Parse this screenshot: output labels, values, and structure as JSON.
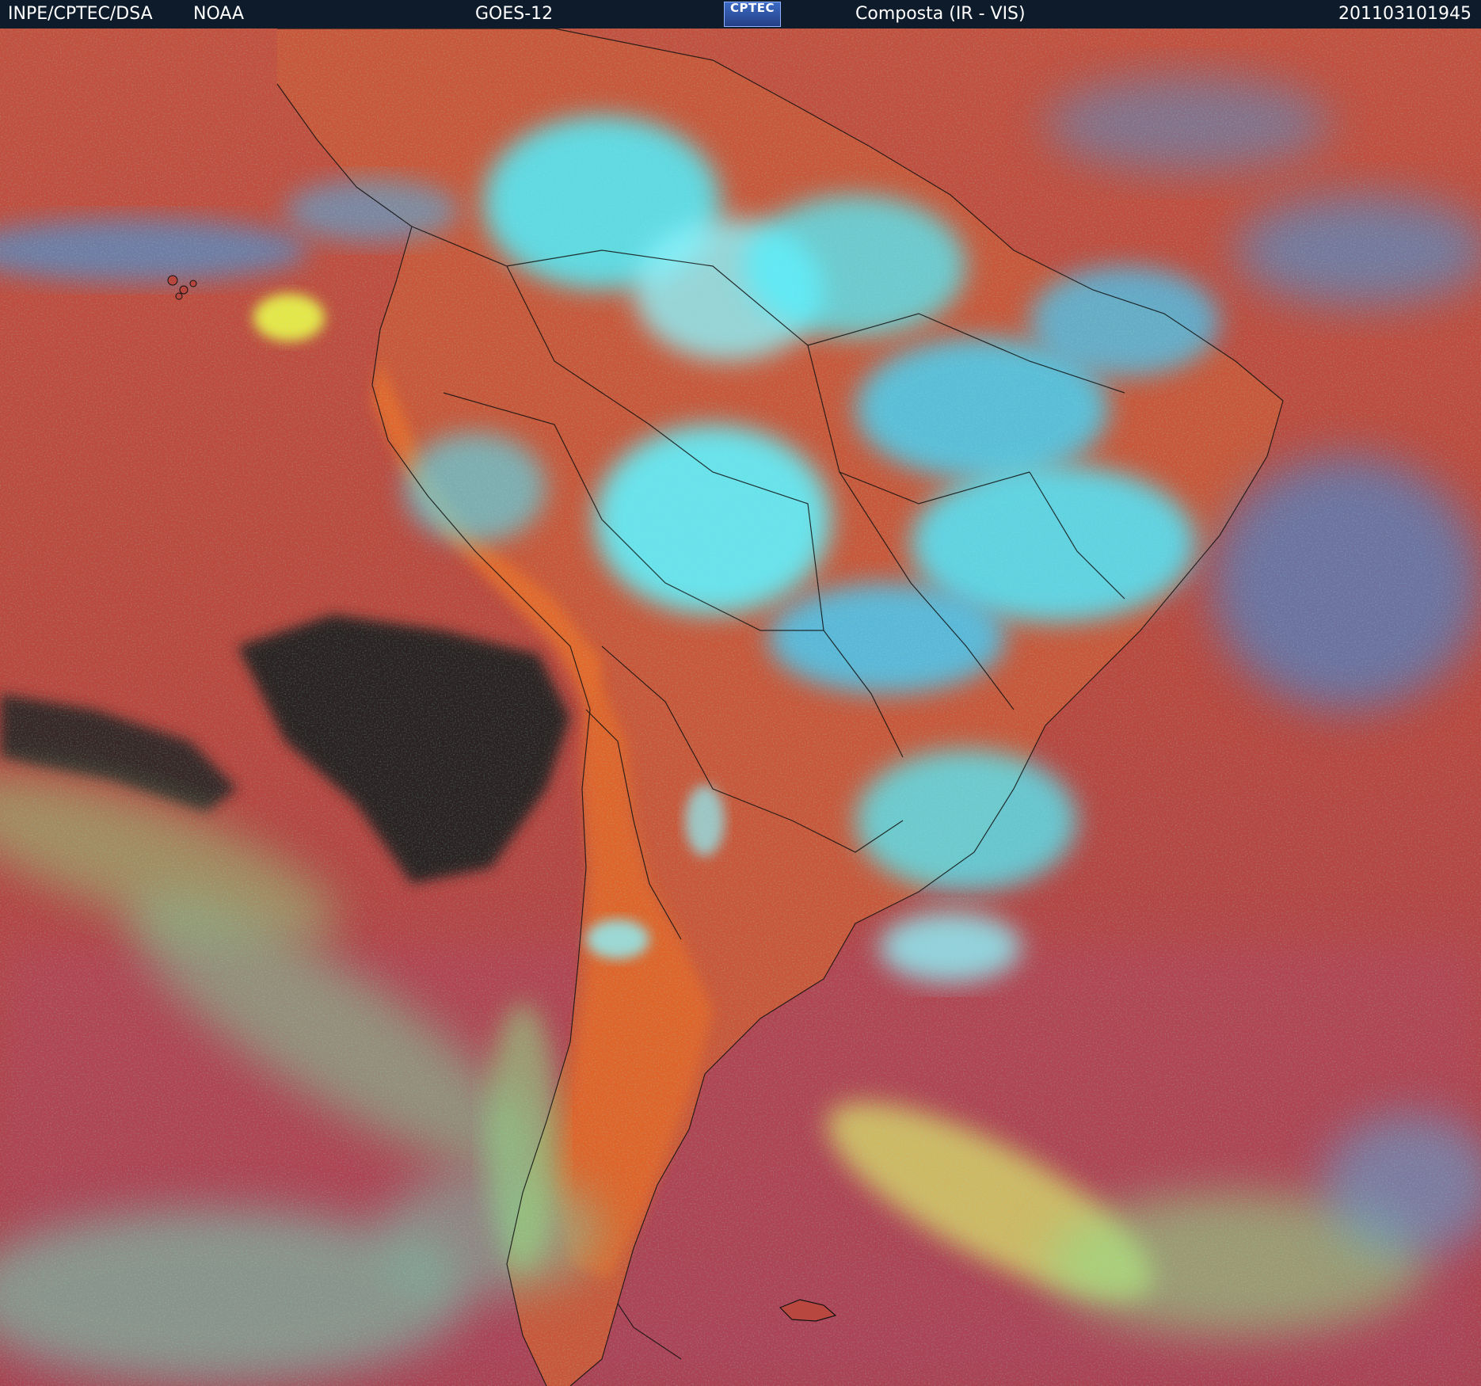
{
  "header": {
    "org": "INPE/CPTEC/DSA",
    "agency": "NOAA",
    "satellite": "GOES-12",
    "logo_text": "CPTEC",
    "product": "Composta (IR - VIS)",
    "timestamp": "201103101945"
  },
  "colors": {
    "header_bg": "#0e1b2a",
    "ocean_red": "#b8473f",
    "land_orange": "#d9622a",
    "cloud_cyan": "#4ff0ff",
    "cloud_blue": "#3a9ce8",
    "cloud_green": "#8fe08a",
    "cloud_yellow": "#d9e06a",
    "dark_clear": "#2a2424",
    "border_line": "#111111"
  }
}
